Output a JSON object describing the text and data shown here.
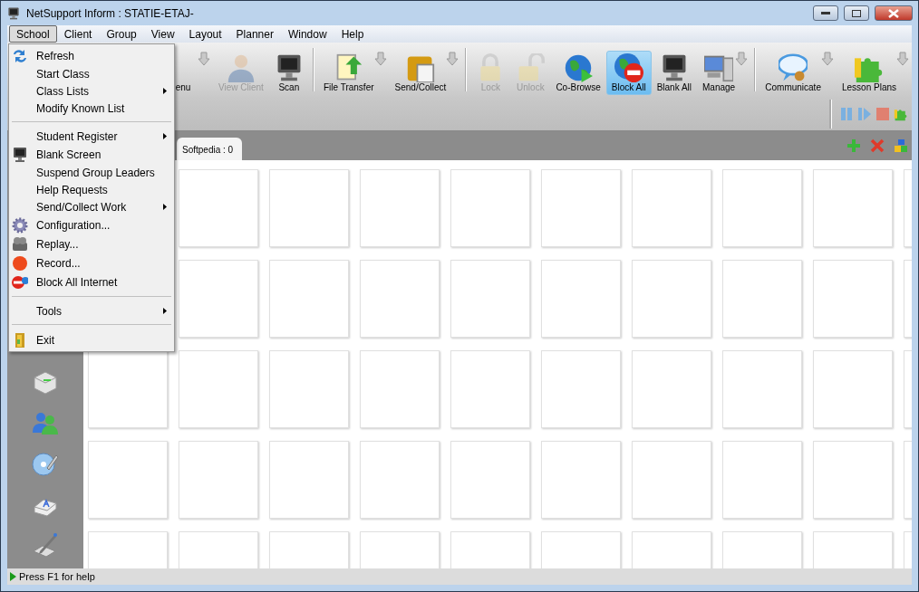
{
  "window": {
    "title": "NetSupport Inform : STATIE-ETAJ-"
  },
  "menu_bar": [
    {
      "label": "School",
      "selected": true
    },
    {
      "label": "Client",
      "selected": false
    },
    {
      "label": "Group",
      "selected": false
    },
    {
      "label": "View",
      "selected": false
    },
    {
      "label": "Layout",
      "selected": false
    },
    {
      "label": "Planner",
      "selected": false
    },
    {
      "label": "Window",
      "selected": false
    },
    {
      "label": "Help",
      "selected": false
    }
  ],
  "school_menu": [
    {
      "kind": "item",
      "label": "Refresh",
      "submenu": false
    },
    {
      "kind": "item",
      "label": "Start Class",
      "submenu": false
    },
    {
      "kind": "item",
      "label": "Class Lists",
      "submenu": true
    },
    {
      "kind": "item",
      "label": "Modify Known List",
      "submenu": false
    },
    {
      "kind": "separator"
    },
    {
      "kind": "item",
      "label": "Student Register",
      "submenu": true
    },
    {
      "kind": "item",
      "label": "Blank Screen",
      "submenu": false
    },
    {
      "kind": "item",
      "label": "Suspend Group Leaders",
      "submenu": false
    },
    {
      "kind": "item",
      "label": "Help Requests",
      "submenu": false
    },
    {
      "kind": "item",
      "label": "Send/Collect Work",
      "submenu": true
    },
    {
      "kind": "item",
      "label": "Configuration...",
      "submenu": false
    },
    {
      "kind": "item",
      "label": "Replay...",
      "submenu": false
    },
    {
      "kind": "item",
      "label": "Record...",
      "submenu": false
    },
    {
      "kind": "item",
      "label": "Block All Internet",
      "submenu": false
    },
    {
      "kind": "separator"
    },
    {
      "kind": "item",
      "label": "Tools",
      "submenu": true
    },
    {
      "kind": "separator"
    },
    {
      "kind": "item",
      "label": "Exit",
      "submenu": false
    }
  ],
  "toolbar": [
    {
      "kind": "button",
      "label": "enu",
      "disabled": false,
      "selected": false,
      "dropdown": true
    },
    {
      "kind": "button",
      "label": "View Client",
      "disabled": true,
      "selected": false,
      "dropdown": false
    },
    {
      "kind": "button",
      "label": "Scan",
      "disabled": false,
      "selected": false,
      "dropdown": false
    },
    {
      "kind": "separator"
    },
    {
      "kind": "button",
      "label": "File Transfer",
      "disabled": false,
      "selected": false,
      "dropdown": true
    },
    {
      "kind": "button",
      "label": "Send/Collect",
      "disabled": false,
      "selected": false,
      "dropdown": true
    },
    {
      "kind": "separator"
    },
    {
      "kind": "button",
      "label": "Lock",
      "disabled": true,
      "selected": false,
      "dropdown": false
    },
    {
      "kind": "button",
      "label": "Unlock",
      "disabled": true,
      "selected": false,
      "dropdown": false
    },
    {
      "kind": "button",
      "label": "Co-Browse",
      "disabled": false,
      "selected": false,
      "dropdown": false
    },
    {
      "kind": "button",
      "label": "Block All",
      "disabled": false,
      "selected": true,
      "dropdown": false
    },
    {
      "kind": "button",
      "label": "Blank All",
      "disabled": false,
      "selected": false,
      "dropdown": false
    },
    {
      "kind": "button",
      "label": "Manage",
      "disabled": false,
      "selected": false,
      "dropdown": true
    },
    {
      "kind": "separator"
    },
    {
      "kind": "button",
      "label": "Communicate",
      "disabled": false,
      "selected": false,
      "dropdown": true
    },
    {
      "kind": "button",
      "label": "Lesson Plans",
      "disabled": false,
      "selected": false,
      "dropdown": true
    }
  ],
  "group_tab": {
    "label": "Softpedia : 0"
  },
  "status_bar": {
    "text": "Press F1 for help"
  }
}
